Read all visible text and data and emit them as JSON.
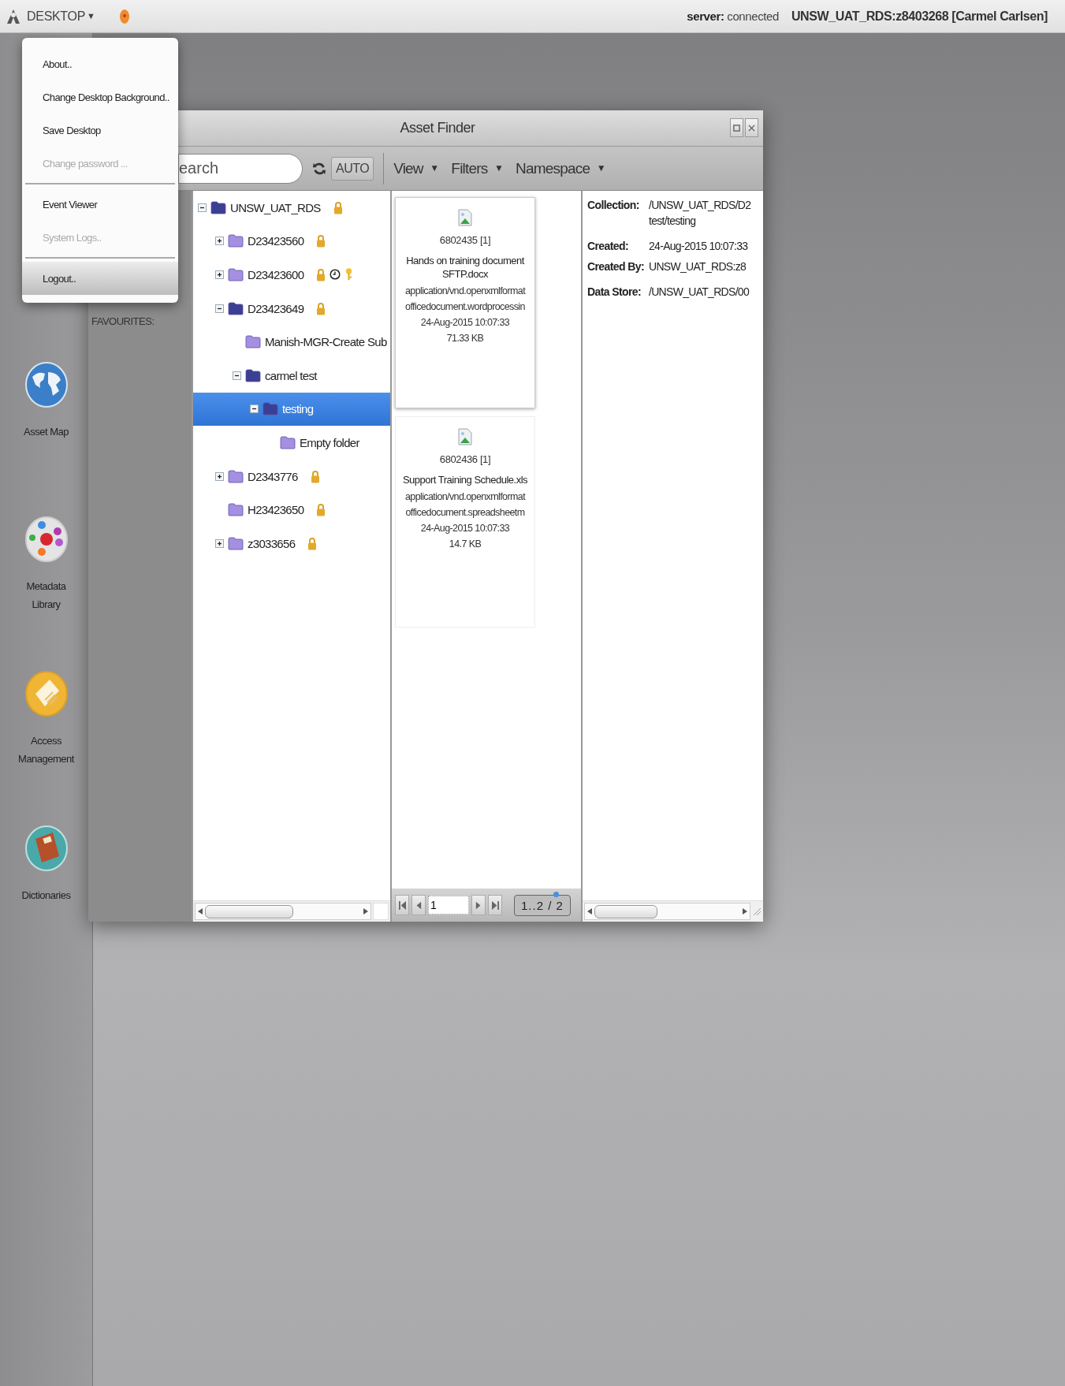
{
  "top_bar": {
    "menu_label": "DESKTOP",
    "menu_caret": "▼",
    "server_label": "server:",
    "server_status": "connected",
    "user": "UNSW_UAT_RDS:z8403268 [Carmel Carlsen]"
  },
  "desktop_menu": {
    "items": [
      {
        "kind": "item",
        "label": "About..",
        "disabled": false,
        "highlighted": false
      },
      {
        "kind": "item",
        "label": "Change Desktop Background..",
        "disabled": false,
        "highlighted": false
      },
      {
        "kind": "item",
        "label": "Save Desktop",
        "disabled": false,
        "highlighted": false
      },
      {
        "kind": "item",
        "label": "Change password ...",
        "disabled": true,
        "highlighted": false
      },
      {
        "kind": "separator"
      },
      {
        "kind": "item",
        "label": "Event Viewer",
        "disabled": false,
        "highlighted": false
      },
      {
        "kind": "item",
        "label": "System Logs..",
        "disabled": true,
        "highlighted": false
      },
      {
        "kind": "separator"
      },
      {
        "kind": "item",
        "label": "Logout..",
        "disabled": false,
        "highlighted": true
      }
    ]
  },
  "dock": [
    {
      "kind": "globe",
      "label": "Asset Map"
    },
    {
      "kind": "metadata",
      "label": "Metadata Library"
    },
    {
      "kind": "access",
      "label": "Access Management"
    },
    {
      "kind": "dictionary",
      "label": "Dictionaries"
    }
  ],
  "window": {
    "title": "Asset Finder",
    "toolbar": {
      "search_placeholder": "earch",
      "auto_label": "AUTO",
      "menus": [
        {
          "label": "View",
          "caret": "▼"
        },
        {
          "label": "Filters",
          "caret": "▼"
        },
        {
          "label": "Namespace",
          "caret": "▼"
        }
      ]
    },
    "sidebar": {
      "heading": "FAVOURITES:"
    },
    "tree": [
      {
        "label": "UNSW_UAT_RDS",
        "kind": "branch",
        "expanded": true,
        "selected": false,
        "locked": true,
        "clock": false,
        "key": false,
        "children": [
          {
            "label": "D23423560",
            "kind": "branch",
            "expanded": false,
            "selected": false,
            "locked": true,
            "clock": false,
            "key": false
          },
          {
            "label": "D23423600",
            "kind": "branch",
            "expanded": false,
            "selected": false,
            "locked": true,
            "clock": true,
            "key": true
          },
          {
            "label": "D23423649",
            "kind": "branch",
            "expanded": true,
            "selected": false,
            "locked": true,
            "clock": false,
            "key": false,
            "children": [
              {
                "label": "Manish-MGR-Create Sub",
                "kind": "leaf",
                "selected": false,
                "locked": false,
                "clock": false,
                "key": false
              },
              {
                "label": "carmel test",
                "kind": "branch",
                "expanded": true,
                "selected": false,
                "locked": false,
                "clock": false,
                "key": false,
                "children": [
                  {
                    "label": "testing",
                    "kind": "branch",
                    "expanded": true,
                    "selected": true,
                    "locked": false,
                    "clock": false,
                    "key": false,
                    "children": [
                      {
                        "label": "Empty folder",
                        "kind": "leaf",
                        "selected": false,
                        "locked": false,
                        "clock": false,
                        "key": false
                      }
                    ]
                  }
                ]
              }
            ]
          },
          {
            "label": "D2343776",
            "kind": "branch",
            "expanded": false,
            "selected": false,
            "locked": true,
            "clock": false,
            "key": false
          },
          {
            "label": "H23423650",
            "kind": "leaf",
            "selected": false,
            "locked": true,
            "clock": false,
            "key": false
          },
          {
            "label": "z3033656",
            "kind": "branch",
            "expanded": false,
            "selected": false,
            "locked": true,
            "clock": false,
            "key": false
          }
        ]
      }
    ],
    "assets": [
      {
        "id": "6802435 [1]",
        "name": "Hands on training document SFTP.docx",
        "mime_lines": [
          "application/vnd.openxmlformat",
          "officedocument.wordprocessin"
        ],
        "modified": "24-Aug-2015 10:07:33",
        "size": "71.33 KB",
        "selected": true
      },
      {
        "id": "6802436 [1]",
        "name": "Support Training Schedule.xls",
        "mime_lines": [
          "application/vnd.openxmlformat",
          "officedocument.spreadsheetm"
        ],
        "modified": "24-Aug-2015 10:07:33",
        "size": "14.7 KB",
        "selected": false
      }
    ],
    "pager": {
      "page_value": "1",
      "range": "1..2 / 2"
    },
    "details": [
      {
        "rows": [
          {
            "label": "Collection:",
            "value_lines": [
              "/UNSW_UAT_RDS/D2",
              "test/testing"
            ]
          }
        ]
      },
      {
        "rows": [
          {
            "label": "Created:",
            "value_lines": [
              "24-Aug-2015 10:07:33"
            ]
          },
          {
            "label": "Created By:",
            "value_lines": [
              "UNSW_UAT_RDS:z8"
            ]
          }
        ]
      },
      {
        "rows": [
          {
            "label": "Data Store:",
            "value_lines": [
              "/UNSW_UAT_RDS/00"
            ]
          }
        ]
      }
    ]
  }
}
